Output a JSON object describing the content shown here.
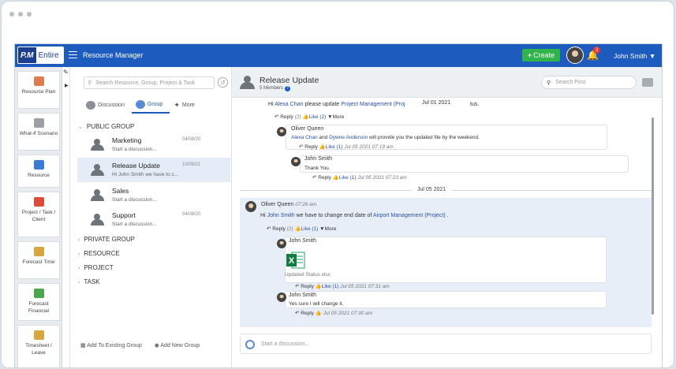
{
  "topbar": {
    "logo_pm": "P.M",
    "logo_text": "Entire",
    "title": "Resource Manager",
    "create_label": "Create",
    "notif_count": "2",
    "user_name": "John Smith"
  },
  "nav": [
    {
      "label": "Resource Plan",
      "icon": "resource-plan-icon",
      "color": "#e07a4f"
    },
    {
      "label": "What-If Scenario",
      "icon": "what-if-icon",
      "color": "#9aa0a6"
    },
    {
      "label": "Resource",
      "icon": "resource-icon",
      "color": "#3a7bd5"
    },
    {
      "label": "Project / Task / Client",
      "icon": "project-icon",
      "color": "#e04a3a"
    },
    {
      "label": "Forecast Time",
      "icon": "forecast-time-icon",
      "color": "#d8a640"
    },
    {
      "label": "Forecast Financial",
      "icon": "forecast-financial-icon",
      "color": "#4ca64c"
    },
    {
      "label": "Timesheet / Leave",
      "icon": "timesheet-icon",
      "color": "#d8a640"
    }
  ],
  "groups_panel": {
    "search_placeholder": "Search Resource, Group, Project & Task",
    "tabs": [
      "Discussion",
      "Group",
      "More"
    ],
    "section_public": "PUBLIC GROUP",
    "groups": [
      {
        "name": "Marketing",
        "date": "04/08/20",
        "msg": "Start a discussion..."
      },
      {
        "name": "Release Update",
        "date": "10/09/21",
        "msg": "Hi John Smith we have to c..."
      },
      {
        "name": "Sales",
        "date": "",
        "msg": "Start a discussion..."
      },
      {
        "name": "Support",
        "date": "04/08/20",
        "msg": "Start a discussion..."
      }
    ],
    "sections": [
      "PRIVATE GROUP",
      "RESOURCE",
      "PROJECT",
      "TASK"
    ],
    "add_existing": "Add To Existing Group",
    "add_new": "Add New Group"
  },
  "main": {
    "title": "Release Update",
    "members": "5 Members",
    "post_search_placeholder": "Search Post",
    "composer_placeholder": "Start a discussion...",
    "actions": {
      "reply": "Reply",
      "like": "Like",
      "more": "More"
    },
    "post1": {
      "hi": "Hi",
      "mention": "Alexa Chan",
      "text": "please update",
      "project": "Project Management (Proj",
      "trail": "tus.",
      "date_float": "Jul 01 2021",
      "reply_count": "(2)",
      "like_count": "(2)"
    },
    "reply1": {
      "author": "Oliver Queen",
      "m1": "Alexa Chan",
      "and": "and",
      "m2": "Dywne Anderson",
      "text": "will provide you the updated file by the weekend.",
      "like_count": "(1)",
      "time": "Jul 05 2021 07:19 am"
    },
    "reply2": {
      "author": "John Smith",
      "text": "Thank You.",
      "like_count": "(1)",
      "time": "Jul 05 2021 07:23 am"
    },
    "date_sep": "Jul 05 2021",
    "post2": {
      "author": "Oliver Queen",
      "time": "07:26 am",
      "hi": "Hi",
      "mention": "John Smith",
      "text": "we have to change end date of",
      "project": "Airport Management (Project)",
      "dot": ".",
      "reply_count": "(2)",
      "like_count": "(1)"
    },
    "reply3": {
      "author": "John Smith",
      "file": "Updated Status.xlsx",
      "like_count": "(1)",
      "time": "Jul 05 2021 07:31 am"
    },
    "reply4": {
      "author": "John Smith",
      "text": "Yes sure I will change it.",
      "time": "Jul 05 2021 07:30 am"
    }
  }
}
